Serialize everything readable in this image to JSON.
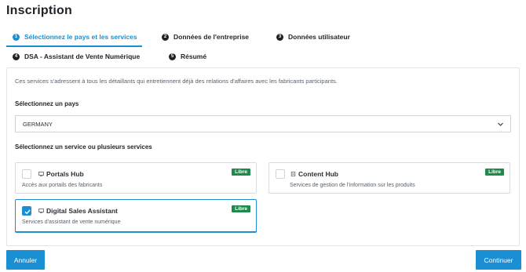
{
  "page_title": "Inscription",
  "steps": [
    {
      "num": "1",
      "label": "Sélectionnez le pays et les services",
      "active": true
    },
    {
      "num": "2",
      "label": "Données de l'entreprise",
      "active": false
    },
    {
      "num": "3",
      "label": "Données utilisateur",
      "active": false
    },
    {
      "num": "4",
      "label": "DSA - Assistant de Vente Numérique",
      "active": false
    },
    {
      "num": "5",
      "label": "Résumé",
      "active": false
    }
  ],
  "intro_text": "Ces services s'adressent à tous les détaillants qui entretiennent déjà des relations d'affaires avec les fabricants participants.",
  "country": {
    "label": "Sélectionnez un pays",
    "selected_value": "GERMANY"
  },
  "services": {
    "label": "Sélectionnez un service ou plusieurs services",
    "items": [
      {
        "title": "Portals Hub",
        "description": "Accès aux portails des fabricants",
        "badge": "Libre",
        "checked": false,
        "icon": "monitor-icon"
      },
      {
        "title": "Content Hub",
        "description": "Services de gestion de l'information sur les produits",
        "badge": "Libre",
        "checked": false,
        "icon": "document-icon"
      },
      {
        "title": "Digital Sales Assistant",
        "description": "Services d'assistant de vente numérique",
        "badge": "Libre",
        "checked": true,
        "icon": "monitor-icon"
      }
    ]
  },
  "buttons": {
    "cancel": "Annuler",
    "continue": "Continuer"
  },
  "colors": {
    "accent": "#1a8fd4",
    "badge": "#1f8a4c"
  }
}
